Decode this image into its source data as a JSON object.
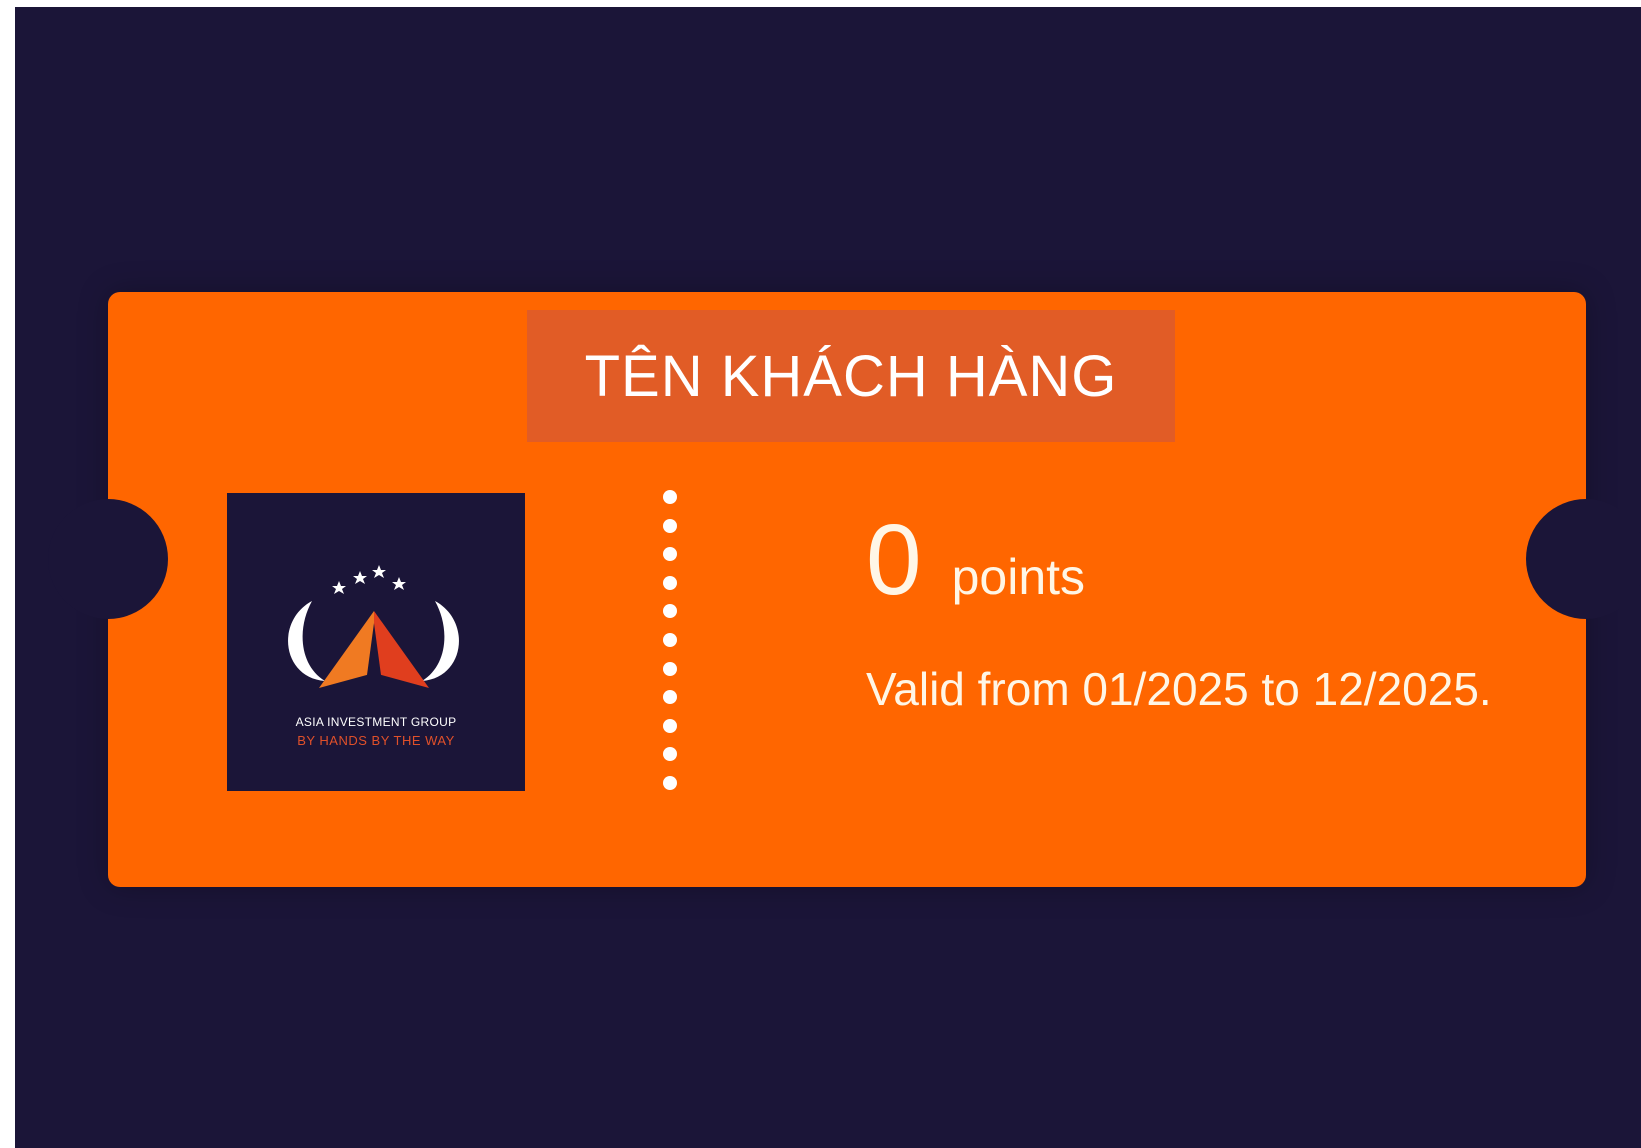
{
  "card": {
    "customer_name": "TÊN KHÁCH HÀNG",
    "points_value": "0",
    "points_unit": "points",
    "validity": "Valid from 01/2025 to 12/2025."
  },
  "logo": {
    "company": "ASIA INVESTMENT GROUP",
    "slogan": "BY HANDS BY THE WAY",
    "icon": "tent-horns-stars-logo"
  },
  "colors": {
    "background": "#1b1538",
    "ticket": "#ff6600",
    "banner": "#e15c26",
    "text": "#fff6e6"
  }
}
